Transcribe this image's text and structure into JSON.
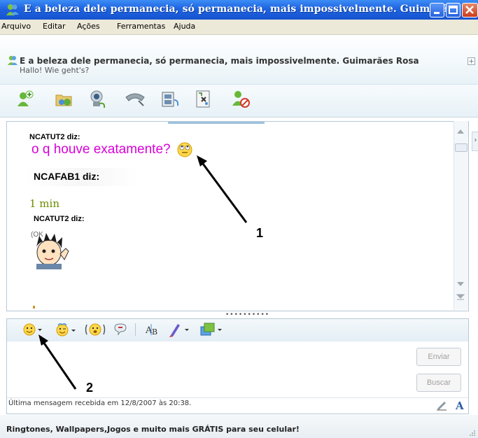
{
  "window": {
    "title": "E a beleza dele permanecia, só permanecia, mais impossivelmente. Guimarã..."
  },
  "menu": {
    "items": [
      "Arquivo",
      "Editar",
      "Ações",
      "Ferramentas",
      "Ajuda"
    ]
  },
  "contact": {
    "name": "E a beleza dele permanecia, só permanecia, mais impossivelmente. Guimarães Rosa",
    "status": "Hallo! Wie geht's?"
  },
  "toolbar": {
    "icons": [
      "invite-contact-icon",
      "send-files-icon",
      "webcam-icon",
      "voice-call-icon",
      "activities-icon",
      "games-icon",
      "block-icon"
    ]
  },
  "conversation": {
    "messages": [
      {
        "sender": "NCATUT2 diz:",
        "text": "o q houve exatamente?",
        "emoticon": "rolling-eyes-emoticon"
      },
      {
        "sender": "NCAFAB1 diz:",
        "text": "1 min"
      },
      {
        "sender": "NCATUT2 diz:",
        "text": "",
        "emoticon": "ok-character-emoticon",
        "emoticon_label": "(OK"
      }
    ]
  },
  "input": {
    "send_label": "Enviar",
    "search_label": "Buscar",
    "toolbar_icons": [
      "emoticon-icon",
      "wink-icon",
      "nudge-icon",
      "voice-clip-icon",
      "font-icon",
      "background-icon",
      "share-icon"
    ]
  },
  "status_bar": {
    "last_message": "Última mensagem recebida em 12/8/2007 às 20:38."
  },
  "ad": {
    "text": "Ringtones, Wallpapers,Jogos e muito mais GRÁTIS para seu celular!"
  },
  "annotations": {
    "label_1": "1",
    "label_2": "2"
  },
  "colors": {
    "titlebar": "#1f63e0",
    "message1_text": "#d800d8",
    "message2_text": "#6b8c00"
  }
}
